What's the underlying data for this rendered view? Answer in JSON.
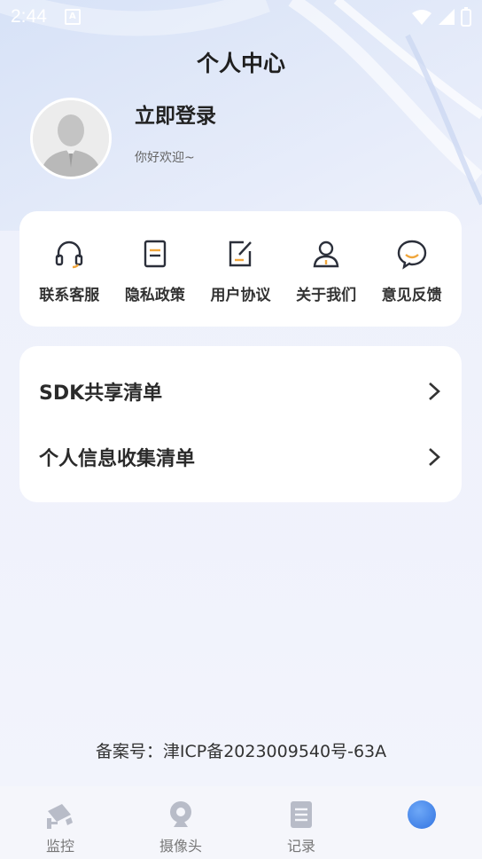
{
  "status_bar": {
    "time": "2:44",
    "notification_badge": "A"
  },
  "header": {
    "title": "个人中心"
  },
  "profile": {
    "login_label": "立即登录",
    "welcome": "你好欢迎~"
  },
  "quick_actions": [
    {
      "label": "联系客服",
      "icon": "headset-icon"
    },
    {
      "label": "隐私政策",
      "icon": "document-icon"
    },
    {
      "label": "用户协议",
      "icon": "edit-icon"
    },
    {
      "label": "关于我们",
      "icon": "person-icon"
    },
    {
      "label": "意见反馈",
      "icon": "chat-bubble-icon"
    }
  ],
  "list_items": [
    {
      "label": "SDK共享清单"
    },
    {
      "label": "个人信息收集清单"
    }
  ],
  "footer": {
    "icp": "备案号：津ICP备2023009540号-63A"
  },
  "tabs": [
    {
      "label": "监控",
      "icon": "security-camera-icon"
    },
    {
      "label": "摄像头",
      "icon": "webcam-icon"
    },
    {
      "label": "记录",
      "icon": "list-doc-icon"
    },
    {
      "label": "",
      "icon": "profile-circle-icon",
      "active": true
    }
  ],
  "colors": {
    "accent": "#f0a63c",
    "active_tab": "#4b8df0",
    "inactive_tab": "#b8bcc8"
  }
}
